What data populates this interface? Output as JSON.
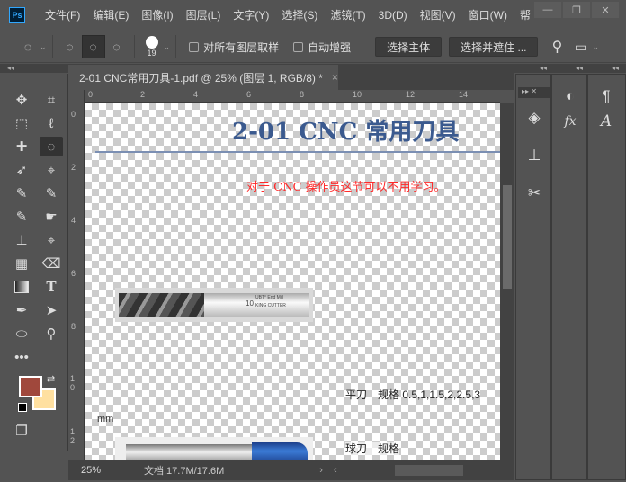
{
  "app": {
    "logo": "Ps"
  },
  "menu": [
    "文件(F)",
    "编辑(E)",
    "图像(I)",
    "图层(L)",
    "文字(Y)",
    "选择(S)",
    "滤镜(T)",
    "3D(D)",
    "视图(V)",
    "窗口(W)",
    "帮"
  ],
  "window_controls": {
    "minimize": "—",
    "restore": "❐",
    "close": "✕"
  },
  "options": {
    "brush_size": "19",
    "sample_all_layers": "对所有图层取样",
    "auto_enhance": "自动增强",
    "select_subject": "选择主体",
    "select_and_mask": "选择并遮住 ..."
  },
  "document": {
    "tab_title": "2-01 CNC常用刀具-1.pdf @ 25% (图层 1, RGB/8) *",
    "close": "×"
  },
  "ruler": {
    "h_ticks": [
      "0",
      "2",
      "4",
      "6",
      "8",
      "10",
      "12",
      "14"
    ],
    "v_ticks": [
      "0",
      "2",
      "4",
      "6",
      "8",
      "10",
      "12"
    ]
  },
  "page": {
    "title": "2-01 CNC 常用刀具",
    "note": "对于 CNC 操作员这节可以不用学习。",
    "flat_cutter": "平刀　规格 0.5,1,1.5,2,2.5,3",
    "unit": "mm",
    "tool_label_num": "10",
    "tool_label_line1": "UBT° End Mill",
    "tool_label_line2": "KING CUTTER",
    "ball_cutter": "球刀　规格"
  },
  "status": {
    "zoom": "25%",
    "doc_size": "文档:17.7M/17.6M"
  },
  "colors": {
    "foreground": "#a0483c",
    "background": "#ffe0a0",
    "title": "#3b5a8f",
    "note": "#ff2a2a"
  }
}
